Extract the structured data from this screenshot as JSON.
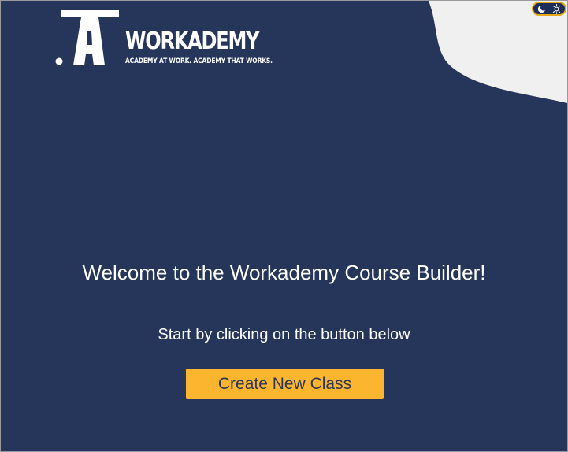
{
  "logo": {
    "name": "WORKADEMY",
    "tagline": "ACADEMY AT WORK. ACADEMY THAT WORKS."
  },
  "theme_toggle": {
    "icons": [
      "moon-icon",
      "sun-icon"
    ]
  },
  "main": {
    "title": "Welcome to the Workademy Course Builder!",
    "subtitle": "Start by clicking on the button below",
    "button_label": "Create New Class"
  },
  "colors": {
    "background": "#26365a",
    "accent": "#fbb52f",
    "corner": "#f0f0f0",
    "button_text": "#2d3652"
  }
}
